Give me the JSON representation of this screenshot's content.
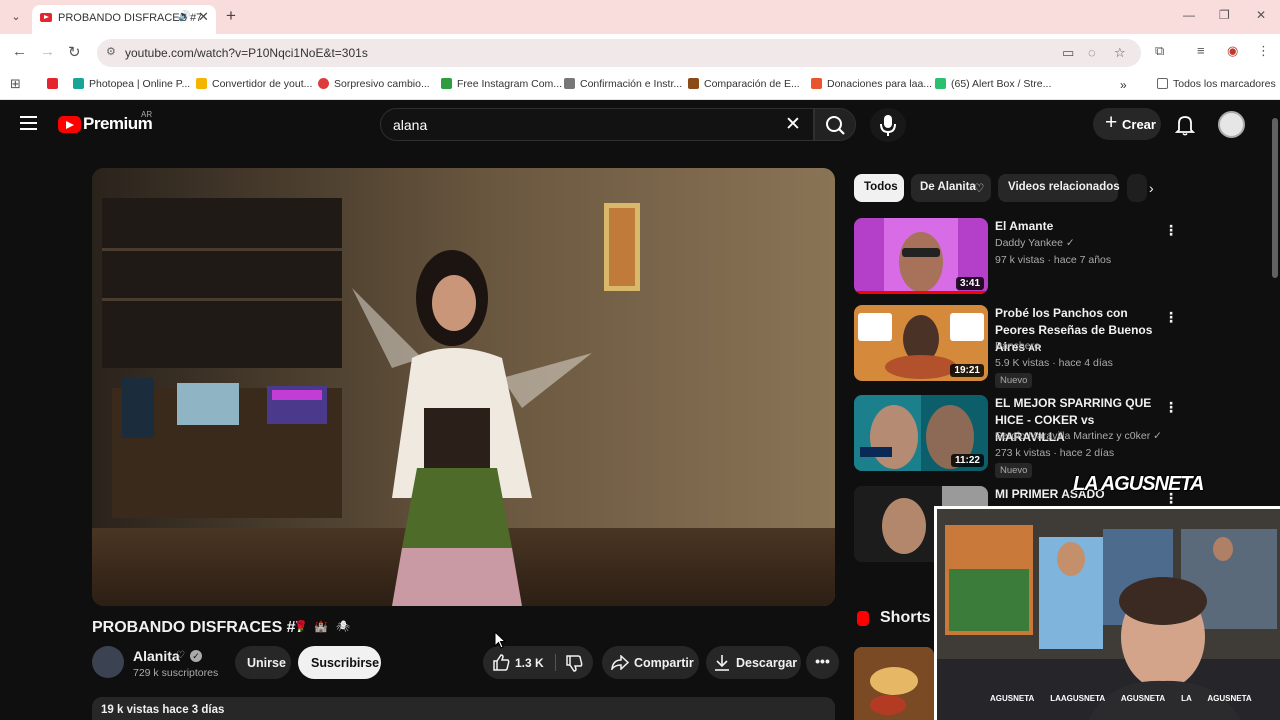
{
  "browser": {
    "tab_title": "PROBANDO DISFRACES #7",
    "url": "youtube.com/watch?v=P10Nqci1NoE&t=301s",
    "bookmarks": [
      {
        "label": "",
        "color": "#e4252d"
      },
      {
        "label": "Photopea | Online P...",
        "color": "#18a497"
      },
      {
        "label": "Convertidor de yout...",
        "color": "#f5b400"
      },
      {
        "label": "Sorpresivo cambio...",
        "color": "#e03b3b"
      },
      {
        "label": "Free Instagram Com...",
        "color": "#2e9c3f"
      },
      {
        "label": "Confirmación e Instr...",
        "color": "#777777"
      },
      {
        "label": "Comparación de E...",
        "color": "#8a4b16"
      },
      {
        "label": "Donaciones para laa...",
        "color": "#e8542e"
      },
      {
        "label": "(65) Alert Box / Stre...",
        "color": "#2cbf6c"
      }
    ],
    "all_bookmarks": "Todos los marcadores"
  },
  "youtube": {
    "logo_text": "Premium",
    "logo_region": "AR",
    "search_query": "alana",
    "create_label": "Crear"
  },
  "video": {
    "title": "PROBANDO DISFRACES #7",
    "channel": "Alanita",
    "subscribers": "729 k suscriptores",
    "join_label": "Unirse",
    "subscribe_label": "Suscribirse",
    "likes": "1.3 K",
    "share_label": "Compartir",
    "download_label": "Descargar",
    "meta": "19 k vistas  hace 3 días"
  },
  "chips": [
    "Todos",
    "De Alanita",
    "Videos relacionados"
  ],
  "recommendations": [
    {
      "title": "El Amante",
      "channel": "Daddy Yankee",
      "meta": "97 k vistas · hace 7 años",
      "duration": "3:41",
      "badge": ""
    },
    {
      "title": "Probé los Panchos con Peores Reseñas de Buenos Aires",
      "title_suffix": "AR",
      "channel": "Panchero",
      "meta": "5.9 K vistas · hace 4 días",
      "duration": "19:21",
      "badge": "Nuevo"
    },
    {
      "title": "EL MEJOR SPARRING QUE HICE - COKER vs MARAVILLA",
      "channel": "Sergio Maravilla Martinez y c0ker",
      "meta": "273 k vistas · hace 2 días",
      "duration": "11:22",
      "badge": "Nuevo"
    },
    {
      "title": "MI PRIMER ASADO ARGENTINO",
      "channel": "",
      "meta": "",
      "duration": "",
      "badge": ""
    }
  ],
  "shorts_label": "Shorts",
  "webcam": {
    "logo": "LA AGUSNETA",
    "handles": [
      "AGUSNETA",
      "LAAGUSNETA",
      "AGUSNETA",
      "LA AGUSNETA"
    ]
  },
  "colors": {
    "brand_red": "#ff0000",
    "background": "#0f0f0f",
    "surface": "#272727",
    "tabstrip": "#f9dcdc"
  }
}
